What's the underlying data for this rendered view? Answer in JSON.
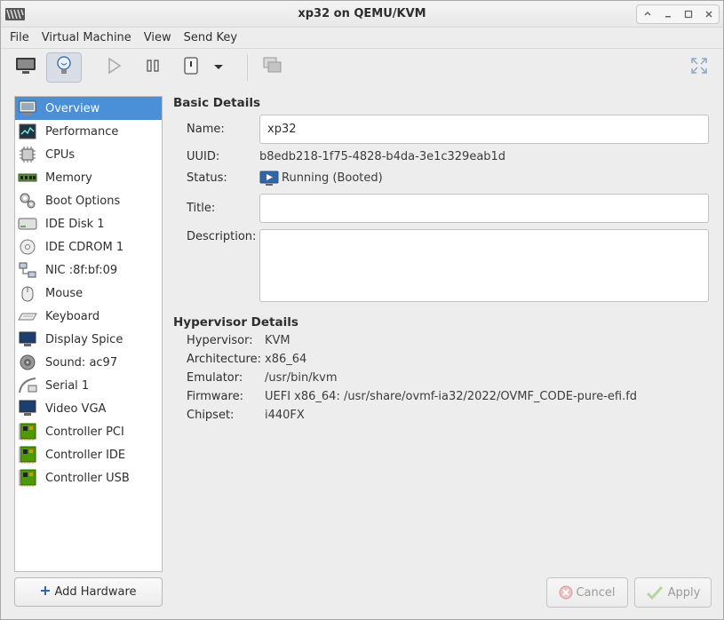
{
  "window": {
    "title": "xp32 on QEMU/KVM",
    "icons": {
      "app": "virt-manager-icon",
      "up": "roll-up-icon",
      "minimize": "minimize-icon",
      "maximize": "maximize-icon",
      "close": "close-icon"
    }
  },
  "menubar": {
    "items": [
      "File",
      "Virtual Machine",
      "View",
      "Send Key"
    ]
  },
  "toolbar": {
    "icons": [
      "monitor-icon",
      "lightbulb-icon",
      "play-icon",
      "pause-icon",
      "power-icon",
      "dropdown-arrow-icon",
      "snapshots-icon",
      "fullscreen-icon"
    ]
  },
  "sidebar": {
    "items": [
      {
        "label": "Overview",
        "icon": "overview-icon",
        "selected": true
      },
      {
        "label": "Performance",
        "icon": "performance-icon"
      },
      {
        "label": "CPUs",
        "icon": "cpu-icon"
      },
      {
        "label": "Memory",
        "icon": "memory-icon"
      },
      {
        "label": "Boot Options",
        "icon": "boot-options-icon"
      },
      {
        "label": "IDE Disk 1",
        "icon": "disk-icon"
      },
      {
        "label": "IDE CDROM 1",
        "icon": "cdrom-icon"
      },
      {
        "label": "NIC :8f:bf:09",
        "icon": "network-icon"
      },
      {
        "label": "Mouse",
        "icon": "mouse-icon"
      },
      {
        "label": "Keyboard",
        "icon": "keyboard-icon"
      },
      {
        "label": "Display Spice",
        "icon": "display-icon"
      },
      {
        "label": "Sound: ac97",
        "icon": "sound-icon"
      },
      {
        "label": "Serial 1",
        "icon": "serial-icon"
      },
      {
        "label": "Video VGA",
        "icon": "video-icon"
      },
      {
        "label": "Controller PCI",
        "icon": "controller-icon"
      },
      {
        "label": "Controller IDE",
        "icon": "controller-icon"
      },
      {
        "label": "Controller USB",
        "icon": "controller-icon"
      }
    ],
    "add_hardware_label": "Add Hardware"
  },
  "basic": {
    "section_title": "Basic Details",
    "name_label": "Name:",
    "name_value": "xp32",
    "uuid_label": "UUID:",
    "uuid_value": "b8edb218-1f75-4828-b4da-3e1c329eab1d",
    "status_label": "Status:",
    "status_value": "Running (Booted)",
    "title_label": "Title:",
    "title_value": "",
    "description_label": "Description:",
    "description_value": ""
  },
  "hypervisor": {
    "section_title": "Hypervisor Details",
    "rows": [
      {
        "label": "Hypervisor:",
        "value": "KVM"
      },
      {
        "label": "Architecture:",
        "value": "x86_64"
      },
      {
        "label": "Emulator:",
        "value": "/usr/bin/kvm"
      },
      {
        "label": "Firmware:",
        "value": "UEFI x86_64: /usr/share/ovmf-ia32/2022/OVMF_CODE-pure-efi.fd"
      },
      {
        "label": "Chipset:",
        "value": "i440FX"
      }
    ]
  },
  "buttons": {
    "cancel_label": "Cancel",
    "apply_label": "Apply"
  },
  "colors": {
    "selection": "#4a90d9",
    "window_bg": "#ededed",
    "controller_green": "#4e9a06"
  }
}
